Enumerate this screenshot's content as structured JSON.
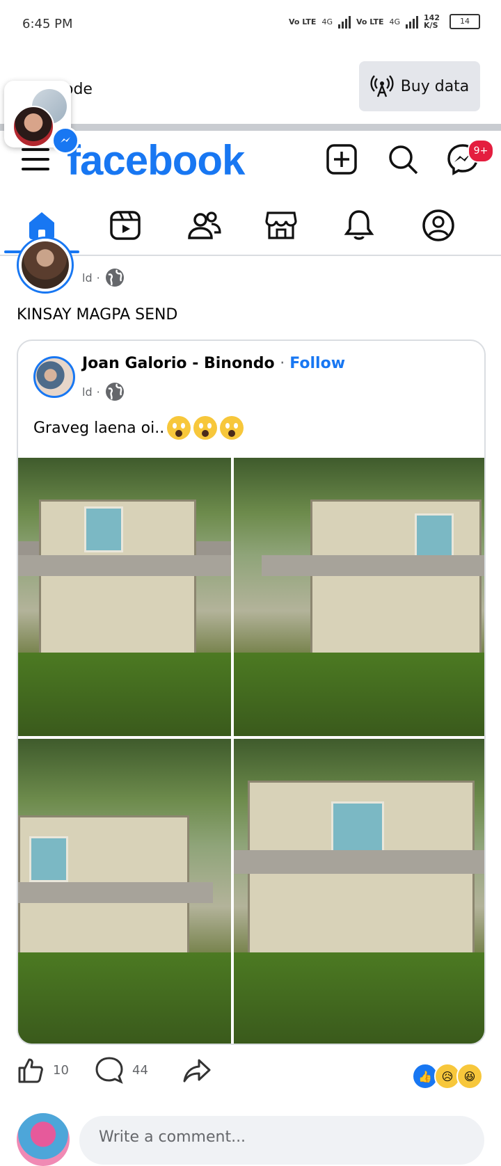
{
  "status_bar": {
    "time": "6:45 PM",
    "sim1": "Vo LTE",
    "net1": "4G",
    "sim2": "Vo LTE",
    "net2": "4G",
    "speed": "142",
    "speed_unit": "K/S",
    "battery": "14"
  },
  "top_strip": {
    "partial_text": "ode",
    "buy_data_label": "Buy data"
  },
  "header": {
    "brand": "facebook",
    "messenger_badge": "9+"
  },
  "nav_tabs": [
    {
      "name": "home",
      "icon": "home-icon",
      "active": true
    },
    {
      "name": "reels",
      "icon": "reels-icon"
    },
    {
      "name": "friends",
      "icon": "friends-icon"
    },
    {
      "name": "marketplace",
      "icon": "marketplace-icon"
    },
    {
      "name": "notifications",
      "icon": "bell-icon"
    },
    {
      "name": "profile",
      "icon": "profile-icon"
    }
  ],
  "post": {
    "time": "ld",
    "text": "KINSAY MAGPA SEND",
    "shared": {
      "author": "Joan Galorio - Binondo",
      "follow_label": "Follow",
      "time": "ld",
      "text": "Graveg laena oi.."
    },
    "likes": "10",
    "comments": "44",
    "reactions": [
      "like",
      "sad",
      "haha"
    ]
  },
  "comment_box": {
    "placeholder": "Write a comment..."
  },
  "colors": {
    "brand": "#1877f2",
    "badge": "#e41e3f",
    "divider": "#dadde1",
    "secondary_text": "#65676b"
  }
}
